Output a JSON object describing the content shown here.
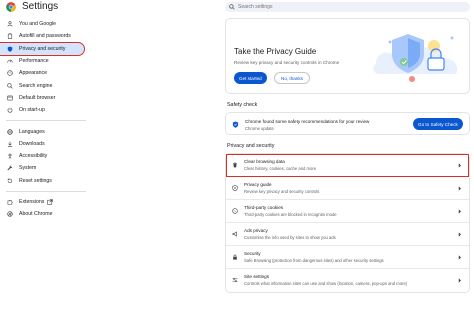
{
  "header": {
    "title": "Settings",
    "search_placeholder": "Search settings"
  },
  "sidebar": {
    "items": [
      {
        "label": "You and Google",
        "icon": "person-icon"
      },
      {
        "label": "Autofill and passwords",
        "icon": "clipboard-icon"
      },
      {
        "label": "Privacy and security",
        "icon": "shield-icon",
        "active": true
      },
      {
        "label": "Performance",
        "icon": "speedometer-icon"
      },
      {
        "label": "Appearance",
        "icon": "palette-icon"
      },
      {
        "label": "Search engine",
        "icon": "search-icon"
      },
      {
        "label": "Default browser",
        "icon": "browser-icon"
      },
      {
        "label": "On start-up",
        "icon": "power-icon"
      },
      {
        "label": "Languages",
        "icon": "globe-icon"
      },
      {
        "label": "Downloads",
        "icon": "download-icon"
      },
      {
        "label": "Accessibility",
        "icon": "accessibility-icon"
      },
      {
        "label": "System",
        "icon": "wrench-icon"
      },
      {
        "label": "Reset settings",
        "icon": "reset-icon"
      },
      {
        "label": "Extensions",
        "icon": "puzzle-icon"
      },
      {
        "label": "About Chrome",
        "icon": "chrome-icon"
      }
    ]
  },
  "privacy_guide": {
    "title": "Take the Privacy Guide",
    "description": "Review key privacy and security controls in Chrome",
    "primary_button": "Get started",
    "secondary_button": "No, thanks"
  },
  "safety_check": {
    "section_title": "Safety check",
    "line1": "Chrome found some safety recommendations for your review",
    "line2": "Chrome update",
    "button": "Go to Safety Check"
  },
  "privacy_security": {
    "section_title": "Privacy and security",
    "rows": [
      {
        "title": "Clear browsing data",
        "subtitle": "Clear history, cookies, cache and more",
        "icon": "trash-icon"
      },
      {
        "title": "Privacy guide",
        "subtitle": "Review key privacy and security controls",
        "icon": "privacy-guide-icon"
      },
      {
        "title": "Third-party cookies",
        "subtitle": "Third-party cookies are blocked in Incognito mode",
        "icon": "cookie-icon"
      },
      {
        "title": "Ads privacy",
        "subtitle": "Customise the info used by sites to show you ads",
        "icon": "ads-icon"
      },
      {
        "title": "Security",
        "subtitle": "Safe Browsing (protection from dangerous sites) and other security settings",
        "icon": "lock-icon"
      },
      {
        "title": "Site settings",
        "subtitle": "Controls what information sites can use and show (location, camera, pop-ups and more)",
        "icon": "sliders-icon"
      }
    ]
  },
  "colors": {
    "accent": "#0b57d0",
    "active_nav": "#d3e3fd",
    "highlight": "#d93025"
  }
}
